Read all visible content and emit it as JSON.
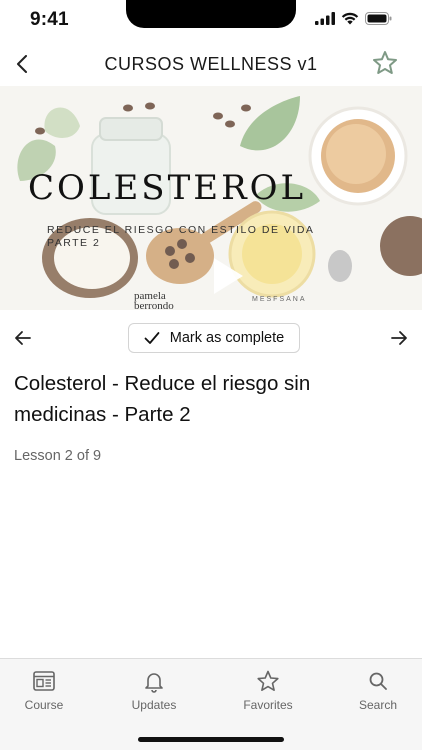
{
  "status_bar": {
    "time": "9:41",
    "icons": [
      "cellular-signal-icon",
      "wifi-icon",
      "battery-icon"
    ]
  },
  "header": {
    "back_icon": "chevron-left-icon",
    "title": "CURSOS WELLNESS v1",
    "favorite_icon": "star-outline-icon"
  },
  "video": {
    "title": "COLESTEROL",
    "subtitle_line1": "REDUCE EL RIESGO CON ESTILO DE VIDA",
    "subtitle_line2": "PARTE 2",
    "brand_left_line1": "pamela",
    "brand_left_line2": "berrondo",
    "brand_right": "MESFSANA",
    "play_icon": "play-icon"
  },
  "lesson_nav": {
    "prev_icon": "arrow-left-icon",
    "next_icon": "arrow-right-icon",
    "complete_label": "Mark as complete",
    "complete_icon": "checkmark-icon"
  },
  "lesson": {
    "title": "Colesterol - Reduce el riesgo sin medicinas - Parte 2",
    "progress_text": "Lesson 2 of 9"
  },
  "tabs": [
    {
      "label": "Course",
      "icon": "course-icon"
    },
    {
      "label": "Updates",
      "icon": "bell-icon"
    },
    {
      "label": "Favorites",
      "icon": "star-icon"
    },
    {
      "label": "Search",
      "icon": "search-icon"
    }
  ],
  "colors": {
    "accent_star": "#7f9a86",
    "tab_icon": "#666666",
    "text_primary": "#111111",
    "text_secondary": "#666666"
  }
}
